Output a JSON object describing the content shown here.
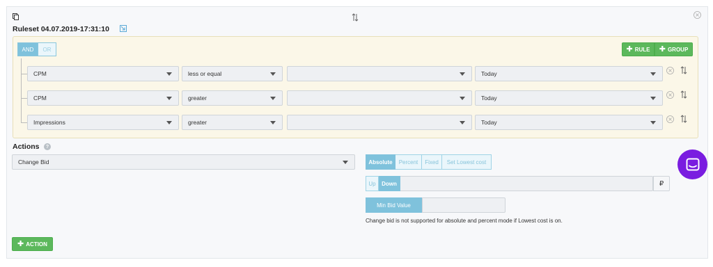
{
  "ruleset": {
    "title": "Ruleset 04.07.2019-17:31:10"
  },
  "logic": {
    "and_label": "AND",
    "or_label": "OR",
    "selected": "AND"
  },
  "group_buttons": {
    "rule_label": "RULE",
    "group_label": "GROUP"
  },
  "rules": [
    {
      "field": "CPM",
      "operator": "less or equal",
      "value": "",
      "period": "Today"
    },
    {
      "field": "CPM",
      "operator": "greater",
      "value": "",
      "period": "Today"
    },
    {
      "field": "Impressions",
      "operator": "greater",
      "value": "",
      "period": "Today"
    }
  ],
  "actions": {
    "label": "Actions",
    "help_icon": "?",
    "selected_action": "Change Bid",
    "mode_tabs": [
      "Absolute",
      "Percent",
      "Fixed",
      "Set Lowest cost"
    ],
    "mode_selected": "Absolute",
    "direction_tabs": [
      "Up",
      "Down"
    ],
    "direction_selected": "Down",
    "amount_value": "",
    "currency_symbol": "₽",
    "min_bid_label": "Min Bid Value",
    "min_bid_value": "",
    "note": "Change bid is not supported for absolute and percent mode if Lowest cost is on.",
    "add_action_label": "ACTION"
  },
  "colors": {
    "accent_blue": "#7fc2dc",
    "green": "#5cb85c",
    "group_bg": "#fbf7e8",
    "intercom": "#7a1de0"
  },
  "icons": [
    "copy-icon",
    "edit-link-icon",
    "sort-icon",
    "close-circle-icon",
    "chevron-down-icon",
    "help-icon",
    "plus-icon",
    "chat-icon"
  ]
}
